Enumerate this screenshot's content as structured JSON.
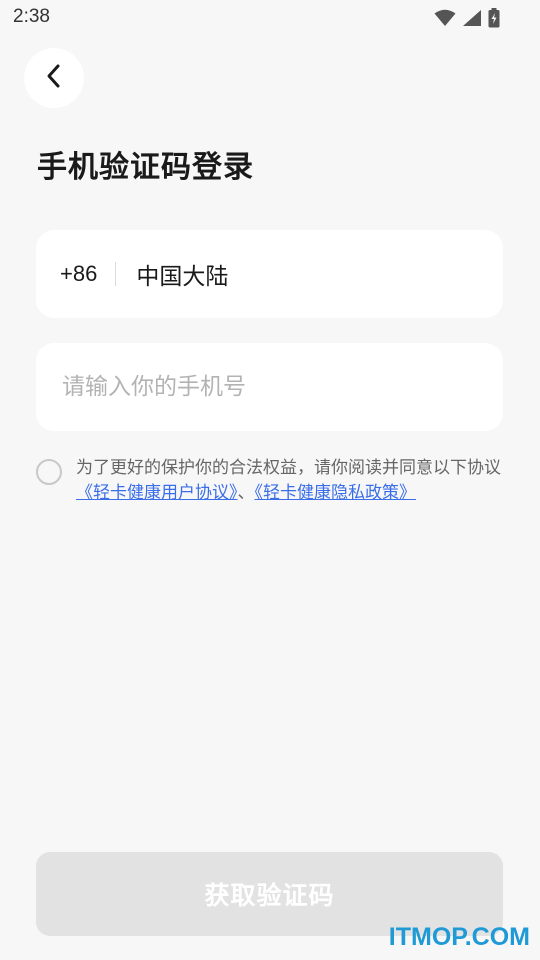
{
  "status_bar": {
    "time": "2:38",
    "icons": [
      "wifi-icon",
      "signal-icon",
      "battery-icon"
    ]
  },
  "header": {
    "back_icon": "chevron-left-icon",
    "title": "手机验证码登录"
  },
  "region": {
    "country_code": "+86",
    "name": "中国大陆"
  },
  "phone": {
    "value": "",
    "placeholder": "请输入你的手机号"
  },
  "agreement": {
    "checked": false,
    "text_before": "为了更好的保护你的合法权益，请你阅读并同意以下协议",
    "link_user": "《轻卡健康用户协议》",
    "separator": "、",
    "link_privacy": "《轻卡健康隐私政策》"
  },
  "actions": {
    "get_code_label": "获取验证码"
  },
  "watermark": "ITMOP.COM",
  "colors": {
    "background": "#f7f7f7",
    "card": "#ffffff",
    "link": "#3a6ee8",
    "button_disabled": "#e2e2e2",
    "watermark": "#1f9ad6"
  }
}
